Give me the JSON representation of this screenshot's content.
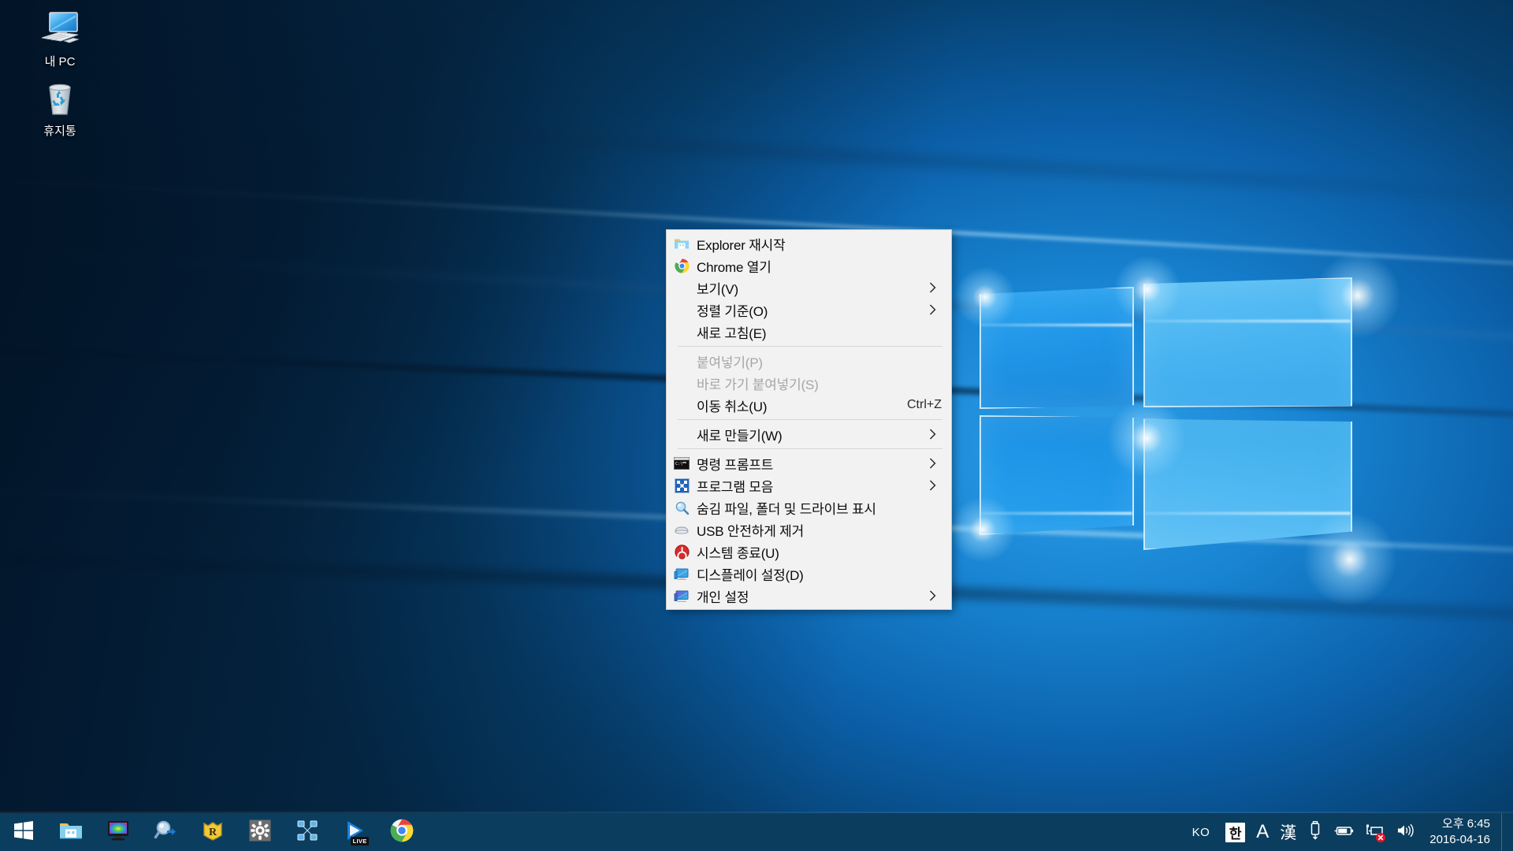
{
  "desktop": {
    "icons": [
      {
        "name": "my-pc",
        "label": "내 PC",
        "icon": "monitor-icon"
      },
      {
        "name": "recycle-bin",
        "label": "휴지통",
        "icon": "recycle-bin-icon"
      }
    ]
  },
  "context_menu": {
    "groups": [
      {
        "items": [
          {
            "label": "Explorer 재시작",
            "icon": "folder-icon",
            "submenu": false,
            "accel": "",
            "disabled": false
          },
          {
            "label": "Chrome 열기",
            "icon": "chrome-icon",
            "submenu": false,
            "accel": "",
            "disabled": false
          },
          {
            "label": "보기(V)",
            "icon": "",
            "submenu": true,
            "accel": "",
            "disabled": false
          },
          {
            "label": "정렬 기준(O)",
            "icon": "",
            "submenu": true,
            "accel": "",
            "disabled": false
          },
          {
            "label": "새로 고침(E)",
            "icon": "",
            "submenu": false,
            "accel": "",
            "disabled": false
          }
        ]
      },
      {
        "items": [
          {
            "label": "붙여넣기(P)",
            "icon": "",
            "submenu": false,
            "accel": "",
            "disabled": true
          },
          {
            "label": "바로 가기 붙여넣기(S)",
            "icon": "",
            "submenu": false,
            "accel": "",
            "disabled": true
          },
          {
            "label": "이동 취소(U)",
            "icon": "",
            "submenu": false,
            "accel": "Ctrl+Z",
            "disabled": false
          }
        ]
      },
      {
        "items": [
          {
            "label": "새로 만들기(W)",
            "icon": "",
            "submenu": true,
            "accel": "",
            "disabled": false
          }
        ]
      },
      {
        "items": [
          {
            "label": "명령 프롬프트",
            "icon": "console-icon",
            "submenu": true,
            "accel": "",
            "disabled": false
          },
          {
            "label": "프로그램 모음",
            "icon": "programs-icon",
            "submenu": true,
            "accel": "",
            "disabled": false
          },
          {
            "label": "숨김 파일, 폴더 및 드라이브 표시",
            "icon": "hidden-files-icon",
            "submenu": false,
            "accel": "",
            "disabled": false
          },
          {
            "label": "USB 안전하게 제거",
            "icon": "usb-eject-icon",
            "submenu": false,
            "accel": "",
            "disabled": false
          },
          {
            "label": "시스템 종료(U)",
            "icon": "power-icon",
            "submenu": false,
            "accel": "",
            "disabled": false
          },
          {
            "label": "디스플레이 설정(D)",
            "icon": "display-icon",
            "submenu": false,
            "accel": "",
            "disabled": false
          },
          {
            "label": "개인 설정",
            "icon": "personalize-icon",
            "submenu": true,
            "accel": "",
            "disabled": false
          }
        ]
      }
    ]
  },
  "taskbar": {
    "buttons": [
      {
        "name": "start-button",
        "icon": "windows-logo-icon"
      },
      {
        "name": "file-explorer",
        "icon": "folder-icon"
      },
      {
        "name": "color-monitor-app",
        "icon": "monitor-color-icon"
      },
      {
        "name": "magnifier-app",
        "icon": "magnifier-arrow-icon"
      },
      {
        "name": "r-app",
        "icon": "r-shield-icon"
      },
      {
        "name": "settings-app",
        "icon": "gear-icon"
      },
      {
        "name": "network-map-app",
        "icon": "network-nodes-icon"
      },
      {
        "name": "live-player-app",
        "icon": "live-play-icon",
        "badge": "LIVE"
      },
      {
        "name": "chrome-app",
        "icon": "chrome-icon"
      }
    ],
    "tray": {
      "ime_language": "KO",
      "ime_hangul": "한",
      "ime_alpha": "A",
      "ime_hanja": "漢",
      "icons": [
        {
          "name": "usb-icon"
        },
        {
          "name": "battery-icon"
        },
        {
          "name": "network-disconnected-icon"
        },
        {
          "name": "volume-icon"
        }
      ]
    },
    "clock": {
      "time": "오후 6:45",
      "date": "2016-04-16"
    }
  },
  "colors": {
    "taskbar": "#0b3d5e",
    "menu_bg": "#f2f2f2",
    "menu_border": "#cfcfcf",
    "disabled_text": "#a6a6a6",
    "accent": "#0078d7",
    "error": "#e81123"
  }
}
